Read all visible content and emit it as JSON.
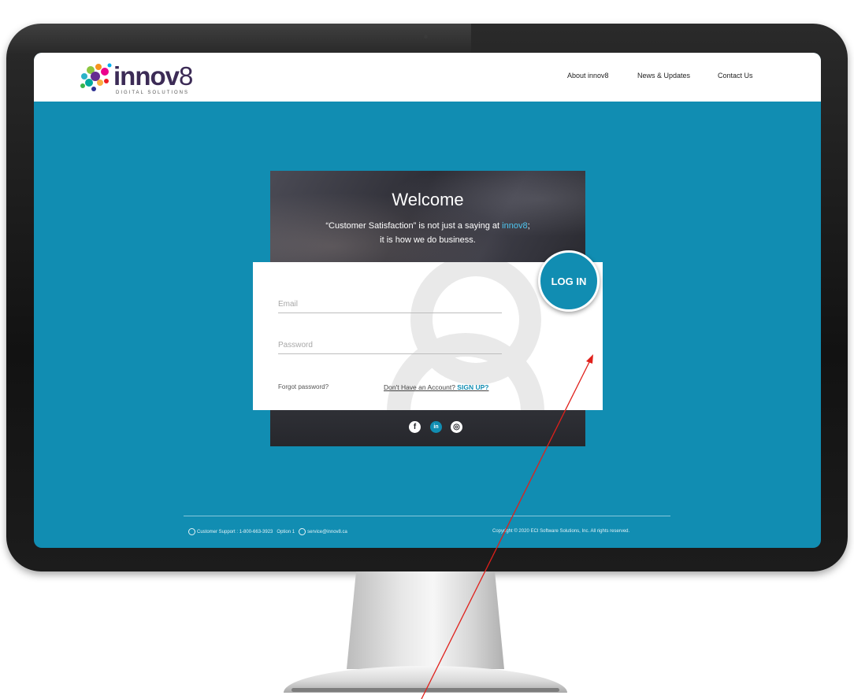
{
  "brand": {
    "name_main": "innov",
    "name_digit": "8",
    "tagline_sub": "DIGITAL SOLUTIONS"
  },
  "nav": {
    "items": [
      {
        "label": "About innov8"
      },
      {
        "label": "News & Updates"
      },
      {
        "label": "Contact Us"
      }
    ]
  },
  "hero": {
    "title": "Welcome",
    "tagline_part1": "“Customer Satisfaction” is not just a saying at ",
    "tagline_brand": "innov8",
    "tagline_part2": ";",
    "tagline_line2": "it is how we do business."
  },
  "form": {
    "email_placeholder": "Email",
    "password_placeholder": "Password",
    "forgot_label": "Forgot password?",
    "signup_prompt": "Don't Have an Account? ",
    "signup_cta": "SIGN UP?",
    "login_label": "LOG IN"
  },
  "social": {
    "facebook": "f",
    "linkedin": "in",
    "instagram": "◎"
  },
  "footer": {
    "support_text": "Customer Support : 1-800-663-3923",
    "option_text": "Option 1",
    "email_text": "service@innov8.ca",
    "copyright": "Copyright © 2020 ECI Software Solutions, Inc. All rights reserved."
  },
  "colors": {
    "page_bg": "#118db2",
    "accent": "#118db2",
    "annotation_arrow": "#e0201b"
  }
}
